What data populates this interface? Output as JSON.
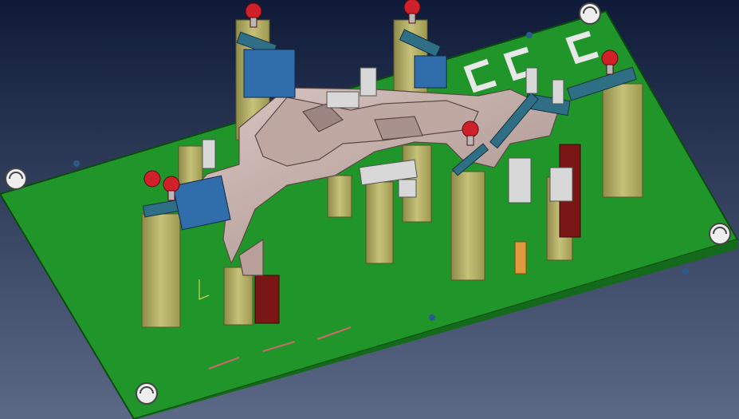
{
  "viewport": {
    "background_top": "#0e1a38",
    "background_bottom": "#5b6987"
  },
  "scene": {
    "baseplate_color": "#1f9a2a",
    "post_color": "#b9b46a",
    "part_color": "#c9aea9",
    "clamp_color": "#2f6f86",
    "block_color": "#2f6eaa",
    "knob_color": "#d0202a",
    "datum_letters": [
      "C",
      "C",
      "C"
    ],
    "marker_color": "#c86a6a"
  }
}
